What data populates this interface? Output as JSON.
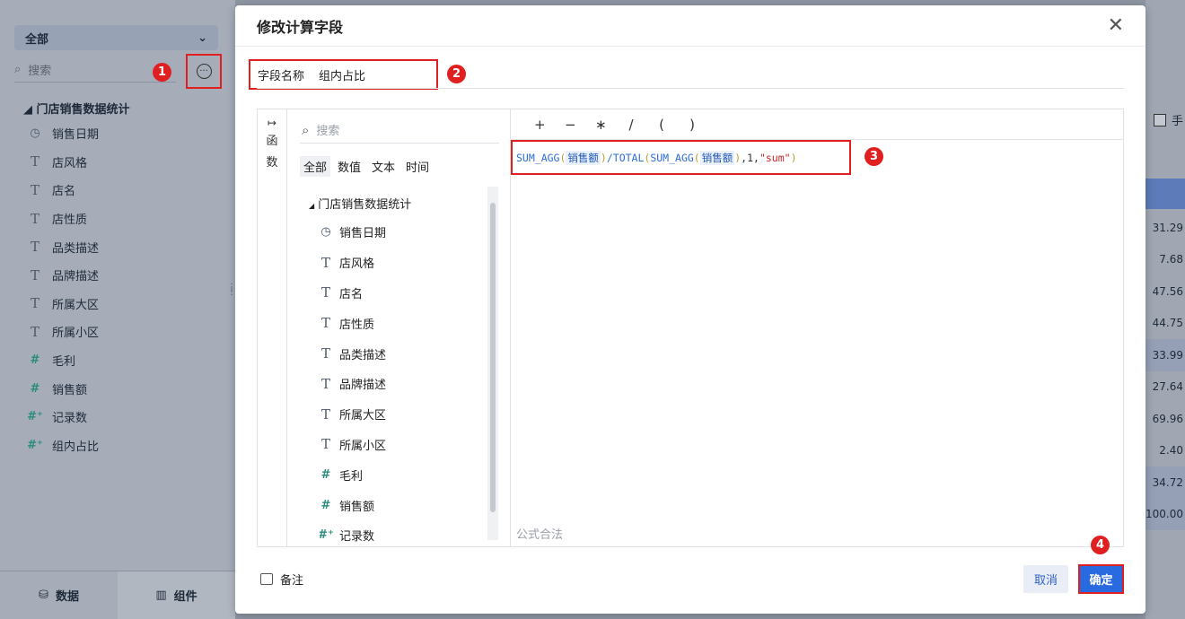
{
  "background": {
    "select_label": "全部",
    "search_placeholder": "搜索",
    "tree_root": "门店销售数据统计",
    "fields": [
      {
        "label": "销售日期",
        "icon": "clock-icon"
      },
      {
        "label": "店风格",
        "icon": "text-type-icon"
      },
      {
        "label": "店名",
        "icon": "text-type-icon"
      },
      {
        "label": "店性质",
        "icon": "text-type-icon"
      },
      {
        "label": "品类描述",
        "icon": "text-type-icon"
      },
      {
        "label": "品牌描述",
        "icon": "text-type-icon"
      },
      {
        "label": "所属大区",
        "icon": "text-type-icon"
      },
      {
        "label": "所属小区",
        "icon": "text-type-icon"
      },
      {
        "label": "毛利",
        "icon": "number-type-icon"
      },
      {
        "label": "销售额",
        "icon": "number-type-icon"
      },
      {
        "label": "记录数",
        "icon": "calc-number-icon"
      },
      {
        "label": "组内占比",
        "icon": "calc-number-icon"
      }
    ],
    "bottom_tabs": [
      "数据",
      "组件"
    ],
    "right_checkbox_label": "手",
    "right_cells": [
      "31.29",
      "7.68",
      "47.56",
      "44.75",
      "33.99",
      "27.64",
      "69.96",
      "2.40",
      "34.72",
      "100.00"
    ]
  },
  "modal": {
    "title": "修改计算字段",
    "field_name_label": "字段名称",
    "field_name_value": "组内占比",
    "function_toggle_label": [
      "函",
      "数"
    ],
    "search_placeholder": "搜索",
    "tabs": [
      "全部",
      "数值",
      "文本",
      "时间"
    ],
    "tree_root": "门店销售数据统计",
    "fields": [
      {
        "label": "销售日期",
        "icon": "clock-icon"
      },
      {
        "label": "店风格",
        "icon": "text-type-icon"
      },
      {
        "label": "店名",
        "icon": "text-type-icon"
      },
      {
        "label": "店性质",
        "icon": "text-type-icon"
      },
      {
        "label": "品类描述",
        "icon": "text-type-icon"
      },
      {
        "label": "品牌描述",
        "icon": "text-type-icon"
      },
      {
        "label": "所属大区",
        "icon": "text-type-icon"
      },
      {
        "label": "所属小区",
        "icon": "text-type-icon"
      },
      {
        "label": "毛利",
        "icon": "number-type-icon"
      },
      {
        "label": "销售额",
        "icon": "number-type-icon"
      },
      {
        "label": "记录数",
        "icon": "calc-number-icon"
      }
    ],
    "operators": [
      "+",
      "−",
      "∗",
      "/",
      "(",
      ")"
    ],
    "formula": {
      "f1": "SUM_AGG",
      "p1": "(",
      "field1": "销售额",
      "p2": ")",
      "sep1": "/TOTAL",
      "p3": "(",
      "f2": "SUM_AGG",
      "p4": "(",
      "field2": "销售额",
      "p5": ")",
      "args": ",1,",
      "str": "\"sum\"",
      "p6": ")"
    },
    "valid_text": "公式合法",
    "remark_label": "备注",
    "cancel_label": "取消",
    "ok_label": "确定"
  },
  "annotations": [
    "1",
    "2",
    "3",
    "4"
  ],
  "colors": {
    "accent": "#2a6ae0",
    "highlight": "#e02020"
  }
}
